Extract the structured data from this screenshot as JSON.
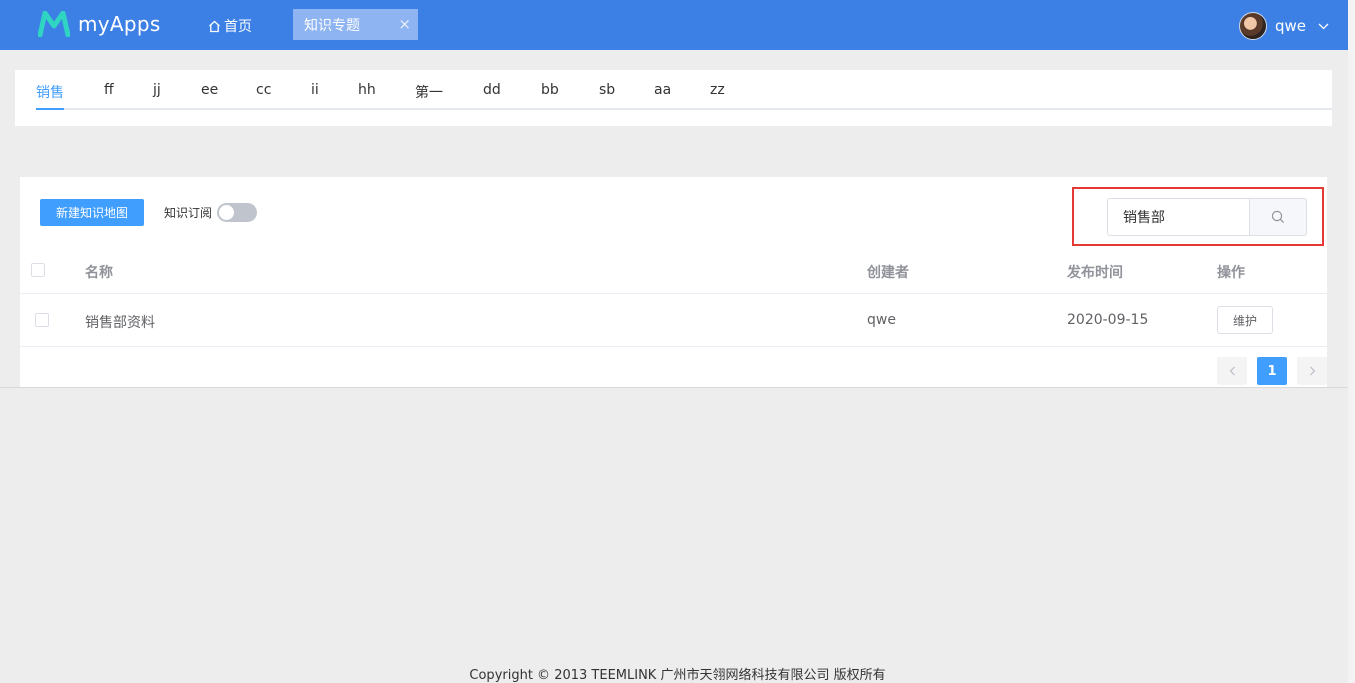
{
  "header": {
    "app_name": "myApps",
    "home_label": "首页",
    "active_tab": "知识专题",
    "tab_close": "×",
    "username": "qwe",
    "brand_color": "#3c80e6"
  },
  "categories": {
    "items": [
      "销售",
      "ff",
      "jj",
      "ee",
      "cc",
      "ii",
      "hh",
      "第一",
      "dd",
      "bb",
      "sb",
      "aa",
      "zz"
    ],
    "active": "销售",
    "active_color": "#409eff"
  },
  "toolbar": {
    "new_button": "新建知识地图",
    "subscribe_label": "知识订阅",
    "subscribe_on": false,
    "search_value": "销售部"
  },
  "table": {
    "columns": [
      "名称",
      "创建者",
      "发布时间",
      "操作"
    ],
    "rows": [
      {
        "name": "销售部资料",
        "creator": "qwe",
        "publish_time": "2020-09-15",
        "action": "维护"
      }
    ]
  },
  "pagination": {
    "current_page": "1",
    "prev_icon": "chevron-left-icon",
    "next_icon": "chevron-right-icon"
  },
  "footer": {
    "copyright": "Copyright © 2013 TEEMLINK 广州市天翎网络科技有限公司 版权所有"
  }
}
